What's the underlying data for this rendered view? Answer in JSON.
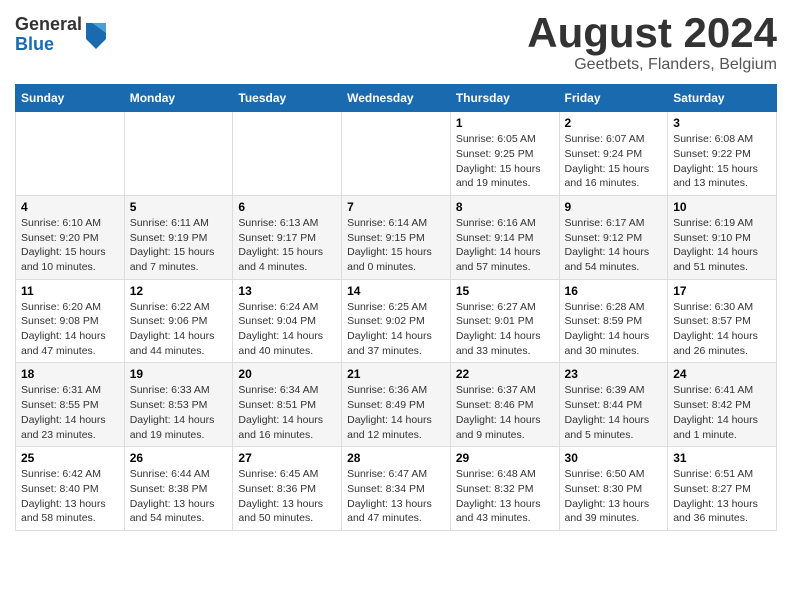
{
  "header": {
    "logo": {
      "line1": "General",
      "line2": "Blue"
    },
    "title": "August 2024",
    "location": "Geetbets, Flanders, Belgium"
  },
  "weekdays": [
    "Sunday",
    "Monday",
    "Tuesday",
    "Wednesday",
    "Thursday",
    "Friday",
    "Saturday"
  ],
  "weeks": [
    [
      {
        "day": "",
        "info": ""
      },
      {
        "day": "",
        "info": ""
      },
      {
        "day": "",
        "info": ""
      },
      {
        "day": "",
        "info": ""
      },
      {
        "day": "1",
        "info": "Sunrise: 6:05 AM\nSunset: 9:25 PM\nDaylight: 15 hours\nand 19 minutes."
      },
      {
        "day": "2",
        "info": "Sunrise: 6:07 AM\nSunset: 9:24 PM\nDaylight: 15 hours\nand 16 minutes."
      },
      {
        "day": "3",
        "info": "Sunrise: 6:08 AM\nSunset: 9:22 PM\nDaylight: 15 hours\nand 13 minutes."
      }
    ],
    [
      {
        "day": "4",
        "info": "Sunrise: 6:10 AM\nSunset: 9:20 PM\nDaylight: 15 hours\nand 10 minutes."
      },
      {
        "day": "5",
        "info": "Sunrise: 6:11 AM\nSunset: 9:19 PM\nDaylight: 15 hours\nand 7 minutes."
      },
      {
        "day": "6",
        "info": "Sunrise: 6:13 AM\nSunset: 9:17 PM\nDaylight: 15 hours\nand 4 minutes."
      },
      {
        "day": "7",
        "info": "Sunrise: 6:14 AM\nSunset: 9:15 PM\nDaylight: 15 hours\nand 0 minutes."
      },
      {
        "day": "8",
        "info": "Sunrise: 6:16 AM\nSunset: 9:14 PM\nDaylight: 14 hours\nand 57 minutes."
      },
      {
        "day": "9",
        "info": "Sunrise: 6:17 AM\nSunset: 9:12 PM\nDaylight: 14 hours\nand 54 minutes."
      },
      {
        "day": "10",
        "info": "Sunrise: 6:19 AM\nSunset: 9:10 PM\nDaylight: 14 hours\nand 51 minutes."
      }
    ],
    [
      {
        "day": "11",
        "info": "Sunrise: 6:20 AM\nSunset: 9:08 PM\nDaylight: 14 hours\nand 47 minutes."
      },
      {
        "day": "12",
        "info": "Sunrise: 6:22 AM\nSunset: 9:06 PM\nDaylight: 14 hours\nand 44 minutes."
      },
      {
        "day": "13",
        "info": "Sunrise: 6:24 AM\nSunset: 9:04 PM\nDaylight: 14 hours\nand 40 minutes."
      },
      {
        "day": "14",
        "info": "Sunrise: 6:25 AM\nSunset: 9:02 PM\nDaylight: 14 hours\nand 37 minutes."
      },
      {
        "day": "15",
        "info": "Sunrise: 6:27 AM\nSunset: 9:01 PM\nDaylight: 14 hours\nand 33 minutes."
      },
      {
        "day": "16",
        "info": "Sunrise: 6:28 AM\nSunset: 8:59 PM\nDaylight: 14 hours\nand 30 minutes."
      },
      {
        "day": "17",
        "info": "Sunrise: 6:30 AM\nSunset: 8:57 PM\nDaylight: 14 hours\nand 26 minutes."
      }
    ],
    [
      {
        "day": "18",
        "info": "Sunrise: 6:31 AM\nSunset: 8:55 PM\nDaylight: 14 hours\nand 23 minutes."
      },
      {
        "day": "19",
        "info": "Sunrise: 6:33 AM\nSunset: 8:53 PM\nDaylight: 14 hours\nand 19 minutes."
      },
      {
        "day": "20",
        "info": "Sunrise: 6:34 AM\nSunset: 8:51 PM\nDaylight: 14 hours\nand 16 minutes."
      },
      {
        "day": "21",
        "info": "Sunrise: 6:36 AM\nSunset: 8:49 PM\nDaylight: 14 hours\nand 12 minutes."
      },
      {
        "day": "22",
        "info": "Sunrise: 6:37 AM\nSunset: 8:46 PM\nDaylight: 14 hours\nand 9 minutes."
      },
      {
        "day": "23",
        "info": "Sunrise: 6:39 AM\nSunset: 8:44 PM\nDaylight: 14 hours\nand 5 minutes."
      },
      {
        "day": "24",
        "info": "Sunrise: 6:41 AM\nSunset: 8:42 PM\nDaylight: 14 hours\nand 1 minute."
      }
    ],
    [
      {
        "day": "25",
        "info": "Sunrise: 6:42 AM\nSunset: 8:40 PM\nDaylight: 13 hours\nand 58 minutes."
      },
      {
        "day": "26",
        "info": "Sunrise: 6:44 AM\nSunset: 8:38 PM\nDaylight: 13 hours\nand 54 minutes."
      },
      {
        "day": "27",
        "info": "Sunrise: 6:45 AM\nSunset: 8:36 PM\nDaylight: 13 hours\nand 50 minutes."
      },
      {
        "day": "28",
        "info": "Sunrise: 6:47 AM\nSunset: 8:34 PM\nDaylight: 13 hours\nand 47 minutes."
      },
      {
        "day": "29",
        "info": "Sunrise: 6:48 AM\nSunset: 8:32 PM\nDaylight: 13 hours\nand 43 minutes."
      },
      {
        "day": "30",
        "info": "Sunrise: 6:50 AM\nSunset: 8:30 PM\nDaylight: 13 hours\nand 39 minutes."
      },
      {
        "day": "31",
        "info": "Sunrise: 6:51 AM\nSunset: 8:27 PM\nDaylight: 13 hours\nand 36 minutes."
      }
    ]
  ]
}
